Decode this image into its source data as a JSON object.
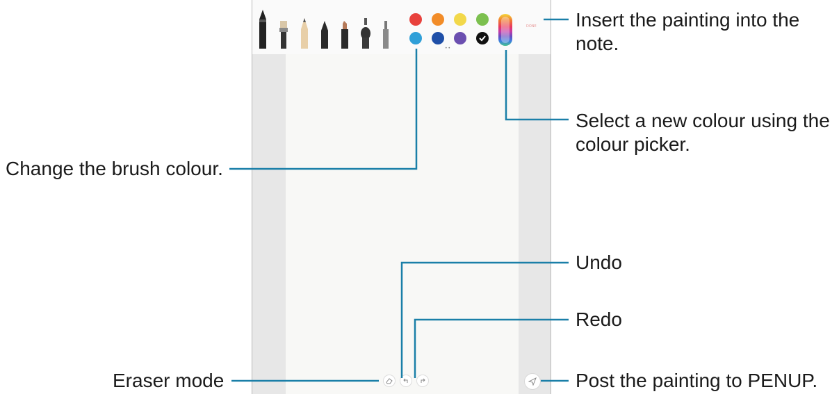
{
  "colors": {
    "accent_line": "#1a7fa8",
    "swatches": [
      "#e8413c",
      "#f28c28",
      "#f2d84a",
      "#7cc04f",
      "#2f9fd8",
      "#1f4fa8",
      "#6b4fb0",
      "#111111"
    ]
  },
  "toolbar": {
    "brushes": [
      "calligraphy-pen",
      "flat-brush",
      "pencil",
      "fountain-pen",
      "marker",
      "spray-brush",
      "crayon"
    ],
    "done_label": "DONE",
    "page_dots": "••"
  },
  "callouts": {
    "insert": {
      "line1": "Insert the painting into the",
      "line2": "note."
    },
    "picker": {
      "line1": "Select a new colour using the",
      "line2": "colour picker."
    },
    "brush_colour": "Change the brush colour.",
    "undo": "Undo",
    "redo": "Redo",
    "eraser": "Eraser mode",
    "post": "Post the painting to PENUP."
  }
}
